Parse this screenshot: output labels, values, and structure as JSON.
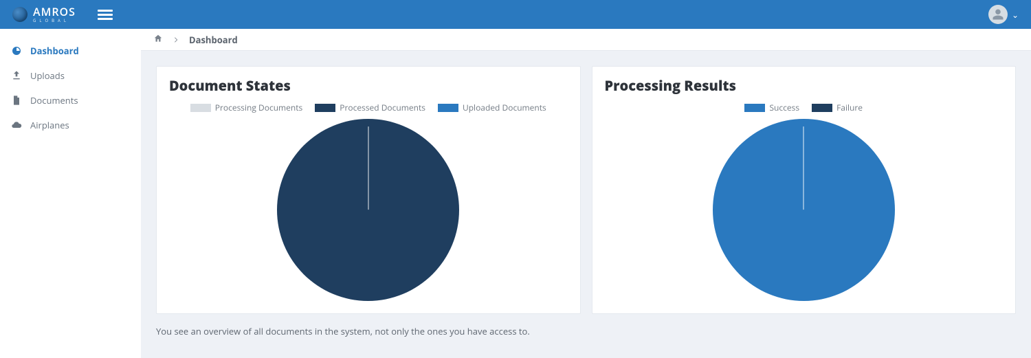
{
  "brand": {
    "name": "AMROS",
    "sub": "GLOBAL"
  },
  "sidebar": {
    "items": [
      {
        "label": "Dashboard",
        "active": true
      },
      {
        "label": "Uploads",
        "active": false
      },
      {
        "label": "Documents",
        "active": false
      },
      {
        "label": "Airplanes",
        "active": false
      }
    ]
  },
  "breadcrumb": {
    "current": "Dashboard"
  },
  "cards": {
    "doc_states": {
      "title": "Document States",
      "legend": [
        {
          "label": "Processing Documents",
          "color": "#d8dde2"
        },
        {
          "label": "Processed Documents",
          "color": "#1f3e5f"
        },
        {
          "label": "Uploaded Documents",
          "color": "#2a79bf"
        }
      ]
    },
    "proc_results": {
      "title": "Processing Results",
      "legend": [
        {
          "label": "Success",
          "color": "#2a79bf"
        },
        {
          "label": "Failure",
          "color": "#1f3e5f"
        }
      ]
    }
  },
  "note": "You see an overview of all documents in the system, not only the ones you have access to.",
  "chart_data": [
    {
      "type": "pie",
      "title": "Document States",
      "series": [
        {
          "name": "Processing Documents",
          "value": 0,
          "color": "#d8dde2"
        },
        {
          "name": "Processed Documents",
          "value": 100,
          "color": "#1f3e5f"
        },
        {
          "name": "Uploaded Documents",
          "value": 0,
          "color": "#2a79bf"
        }
      ]
    },
    {
      "type": "pie",
      "title": "Processing Results",
      "series": [
        {
          "name": "Success",
          "value": 100,
          "color": "#2a79bf"
        },
        {
          "name": "Failure",
          "value": 0,
          "color": "#1f3e5f"
        }
      ]
    }
  ]
}
